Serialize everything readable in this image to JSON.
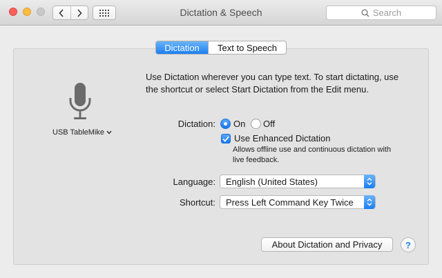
{
  "window": {
    "title": "Dictation & Speech",
    "search_placeholder": "Search"
  },
  "tabs": [
    {
      "label": "Dictation",
      "active": true
    },
    {
      "label": "Text to Speech",
      "active": false
    }
  ],
  "microphone": {
    "label": "USB TableMike",
    "icon": "microphone-icon"
  },
  "description": "Use Dictation wherever you can type text. To start dictating, use the shortcut or select Start Dictation from the Edit menu.",
  "dictation": {
    "label": "Dictation:",
    "on_label": "On",
    "off_label": "Off",
    "selected": "On",
    "enhanced_label": "Use Enhanced Dictation",
    "enhanced_checked": true,
    "enhanced_note": "Allows offline use and continuous dictation with live feedback."
  },
  "language": {
    "label": "Language:",
    "value": "English (United States)"
  },
  "shortcut": {
    "label": "Shortcut:",
    "value": "Press Left Command Key Twice"
  },
  "buttons": {
    "about": "About Dictation and Privacy",
    "help": "?"
  },
  "colors": {
    "accent": "#1a7ff3",
    "close": "#fc605c",
    "minimize": "#fdbc40"
  }
}
